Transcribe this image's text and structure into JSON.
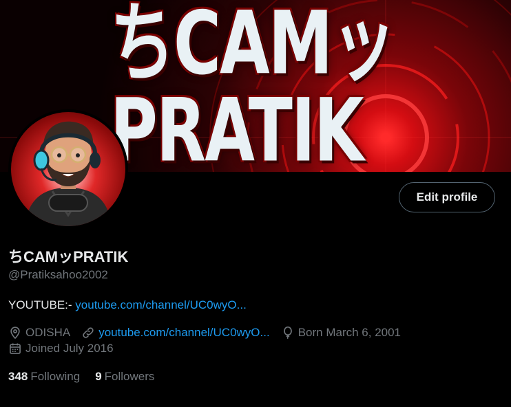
{
  "banner": {
    "title": "ちCAMッPRATIK"
  },
  "profile": {
    "display_name": "ちCAMッPRATIK",
    "handle": "@Pratiksahoo2002",
    "bio_prefix": "YOUTUBE:- ",
    "bio_link": "youtube.com/channel/UC0wyO...",
    "location": "ODISHA",
    "website": "youtube.com/channel/UC0wyO...",
    "birthday": "Born March 6, 2001",
    "joined": "Joined July 2016",
    "following_count": "348",
    "following_label": "Following",
    "followers_count": "9",
    "followers_label": "Followers"
  },
  "actions": {
    "edit_profile": "Edit profile"
  },
  "icons": {
    "location": "map-pin-icon",
    "website": "link-icon",
    "birthday": "balloon-icon",
    "joined": "calendar-icon"
  },
  "colors": {
    "background": "#000000",
    "text_primary": "#e7e9ea",
    "text_secondary": "#71767b",
    "link": "#1d9bf0",
    "button_border": "#536471",
    "banner_red": "#d40d12"
  }
}
